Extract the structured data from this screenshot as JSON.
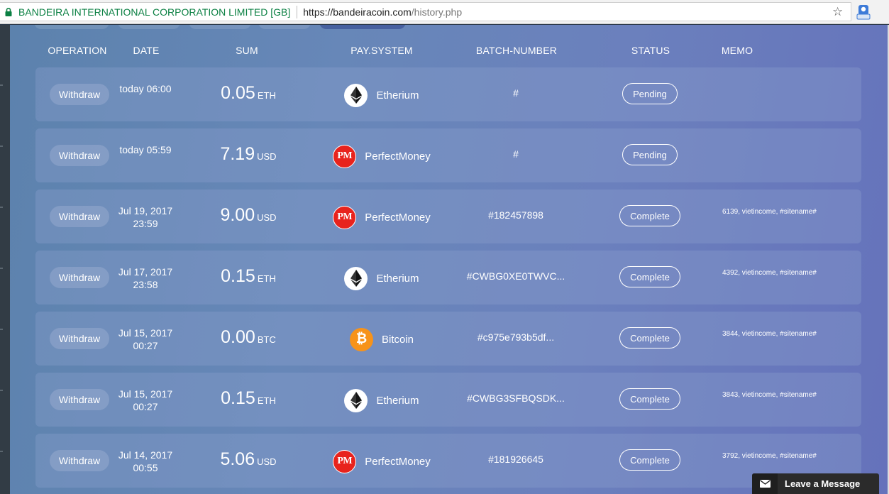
{
  "browser": {
    "site_name": "BANDEIRA INTERNATIONAL CORPORATION LIMITED [GB]",
    "url_host": "https://bandeiracoin.com",
    "url_path": "/history.php"
  },
  "table": {
    "headers": [
      "OPERATION",
      "DATE",
      "SUM",
      "PAY.SYSTEM",
      "BATCH-NUMBER",
      "STATUS",
      "MEMO"
    ],
    "rows": [
      {
        "operation": "Withdraw",
        "date1": "today 06:00",
        "date2": "",
        "amount": "0.05",
        "currency": "ETH",
        "pay_icon": "ethereum-icon",
        "pay_system": "Etherium",
        "batch": "#",
        "status": "Pending",
        "memo": ""
      },
      {
        "operation": "Withdraw",
        "date1": "today 05:59",
        "date2": "",
        "amount": "7.19",
        "currency": "USD",
        "pay_icon": "perfectmoney-icon",
        "pay_system": "PerfectMoney",
        "batch": "#",
        "status": "Pending",
        "memo": ""
      },
      {
        "operation": "Withdraw",
        "date1": "Jul 19, 2017",
        "date2": "23:59",
        "amount": "9.00",
        "currency": "USD",
        "pay_icon": "perfectmoney-icon",
        "pay_system": "PerfectMoney",
        "batch": "#182457898",
        "status": "Complete",
        "memo": "6139, vietincome, #sitename#"
      },
      {
        "operation": "Withdraw",
        "date1": "Jul 17, 2017",
        "date2": "23:58",
        "amount": "0.15",
        "currency": "ETH",
        "pay_icon": "ethereum-icon",
        "pay_system": "Etherium",
        "batch": "#CWBG0XE0TWVC...",
        "status": "Complete",
        "memo": "4392, vietincome, #sitename#"
      },
      {
        "operation": "Withdraw",
        "date1": "Jul 15, 2017",
        "date2": "00:27",
        "amount": "0.00",
        "currency": "BTC",
        "pay_icon": "bitcoin-icon",
        "pay_system": "Bitcoin",
        "batch": "#c975e793b5df...",
        "status": "Complete",
        "memo": "3844, vietincome, #sitename#"
      },
      {
        "operation": "Withdraw",
        "date1": "Jul 15, 2017",
        "date2": "00:27",
        "amount": "0.15",
        "currency": "ETH",
        "pay_icon": "ethereum-icon",
        "pay_system": "Etherium",
        "batch": "#CWBG3SFBQSDK...",
        "status": "Complete",
        "memo": "3843, vietincome, #sitename#"
      },
      {
        "operation": "Withdraw",
        "date1": "Jul 14, 2017",
        "date2": "00:55",
        "amount": "5.06",
        "currency": "USD",
        "pay_icon": "perfectmoney-icon",
        "pay_system": "PerfectMoney",
        "batch": "#181926645",
        "status": "Complete",
        "memo": "3792, vietincome, #sitename#"
      }
    ]
  },
  "chat": {
    "label": "Leave a Message"
  },
  "colors": {
    "pm_red": "#e8231d",
    "btc_orange": "#f7931a",
    "secure_green": "#0b8043"
  }
}
